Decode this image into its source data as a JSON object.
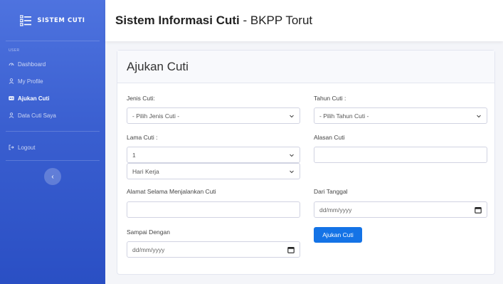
{
  "sidebar": {
    "brand": "SISTEM CUTI",
    "heading": "USER",
    "items": [
      {
        "label": "Dashboard",
        "icon": "dashboard-icon"
      },
      {
        "label": "My Profile",
        "icon": "user-icon"
      },
      {
        "label": "Ajukan Cuti",
        "icon": "id-card-icon"
      },
      {
        "label": "Data Cuti Saya",
        "icon": "users-icon"
      }
    ],
    "logout": "Logout",
    "toggle": "‹"
  },
  "topbar": {
    "title_bold": "Sistem Informasi Cuti",
    "title_rest": " - BKPP Torut"
  },
  "card": {
    "title": "Ajukan Cuti"
  },
  "form": {
    "jenis_label": "Jenis Cuti:",
    "jenis_value": "- Pilih Jenis Cuti -",
    "tahun_label": "Tahun Cuti :",
    "tahun_value": "- Pilih Tahun Cuti -",
    "lama_label": "Lama Cuti :",
    "lama_value": "1",
    "lama_unit": "Hari Kerja",
    "alasan_label": "Alasan Cuti",
    "alasan_value": "",
    "alamat_label": "Alamat Selama Menjalankan Cuti",
    "alamat_value": "",
    "dari_label": "Dari Tanggal",
    "dari_placeholder": "dd/mm/yyyy",
    "sampai_label": "Sampai Dengan",
    "sampai_placeholder": "dd/mm/yyyy",
    "submit": "Ajukan Cuti"
  },
  "colors": {
    "sidebar_top": "#4e73df",
    "sidebar_bottom": "#2a4fc4",
    "primary_button": "#1473e6"
  }
}
